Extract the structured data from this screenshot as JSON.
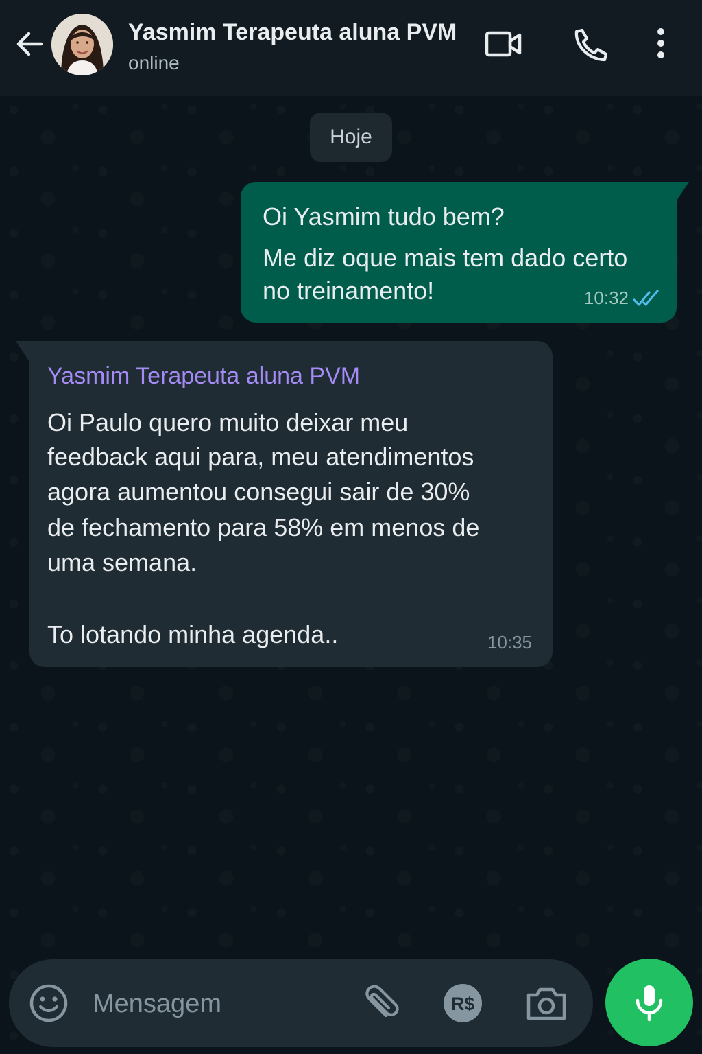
{
  "header": {
    "contact_name": "Yasmim Terapeuta aluna PVM",
    "status": "online",
    "icons": [
      "back-arrow-icon",
      "video-call-icon",
      "phone-icon",
      "more-vertical-icon"
    ]
  },
  "chat": {
    "date_label": "Hoje",
    "messages": [
      {
        "direction": "outgoing",
        "lines": [
          "Oi Yasmim tudo bem?",
          "Me diz oque mais tem dado certo",
          "no treinamento!"
        ],
        "time": "10:32",
        "status": "read"
      },
      {
        "direction": "incoming",
        "sender": "Yasmim Terapeuta aluna PVM",
        "lines": [
          "Oi Paulo quero muito deixar meu",
          "feedback aqui para, meu atendimentos",
          "agora aumentou consegui sair de 30%",
          "de fechamento para 58% em menos de",
          "uma semana.",
          "",
          "To lotando minha agenda.."
        ],
        "time": "10:35"
      }
    ]
  },
  "composer": {
    "placeholder": "Mensagem",
    "value": "",
    "pay_label": "R$",
    "icons": [
      "emoji-icon",
      "attach-icon",
      "payment-icon",
      "camera-icon",
      "microphone-icon"
    ]
  },
  "colors": {
    "background": "#0b141a",
    "header": "#111b21",
    "outgoing_bubble": "#005c4b",
    "incoming_bubble": "#202c33",
    "sender_name": "#a48bf5",
    "read_ticks": "#53bdeb",
    "mic_button": "#21c063"
  }
}
